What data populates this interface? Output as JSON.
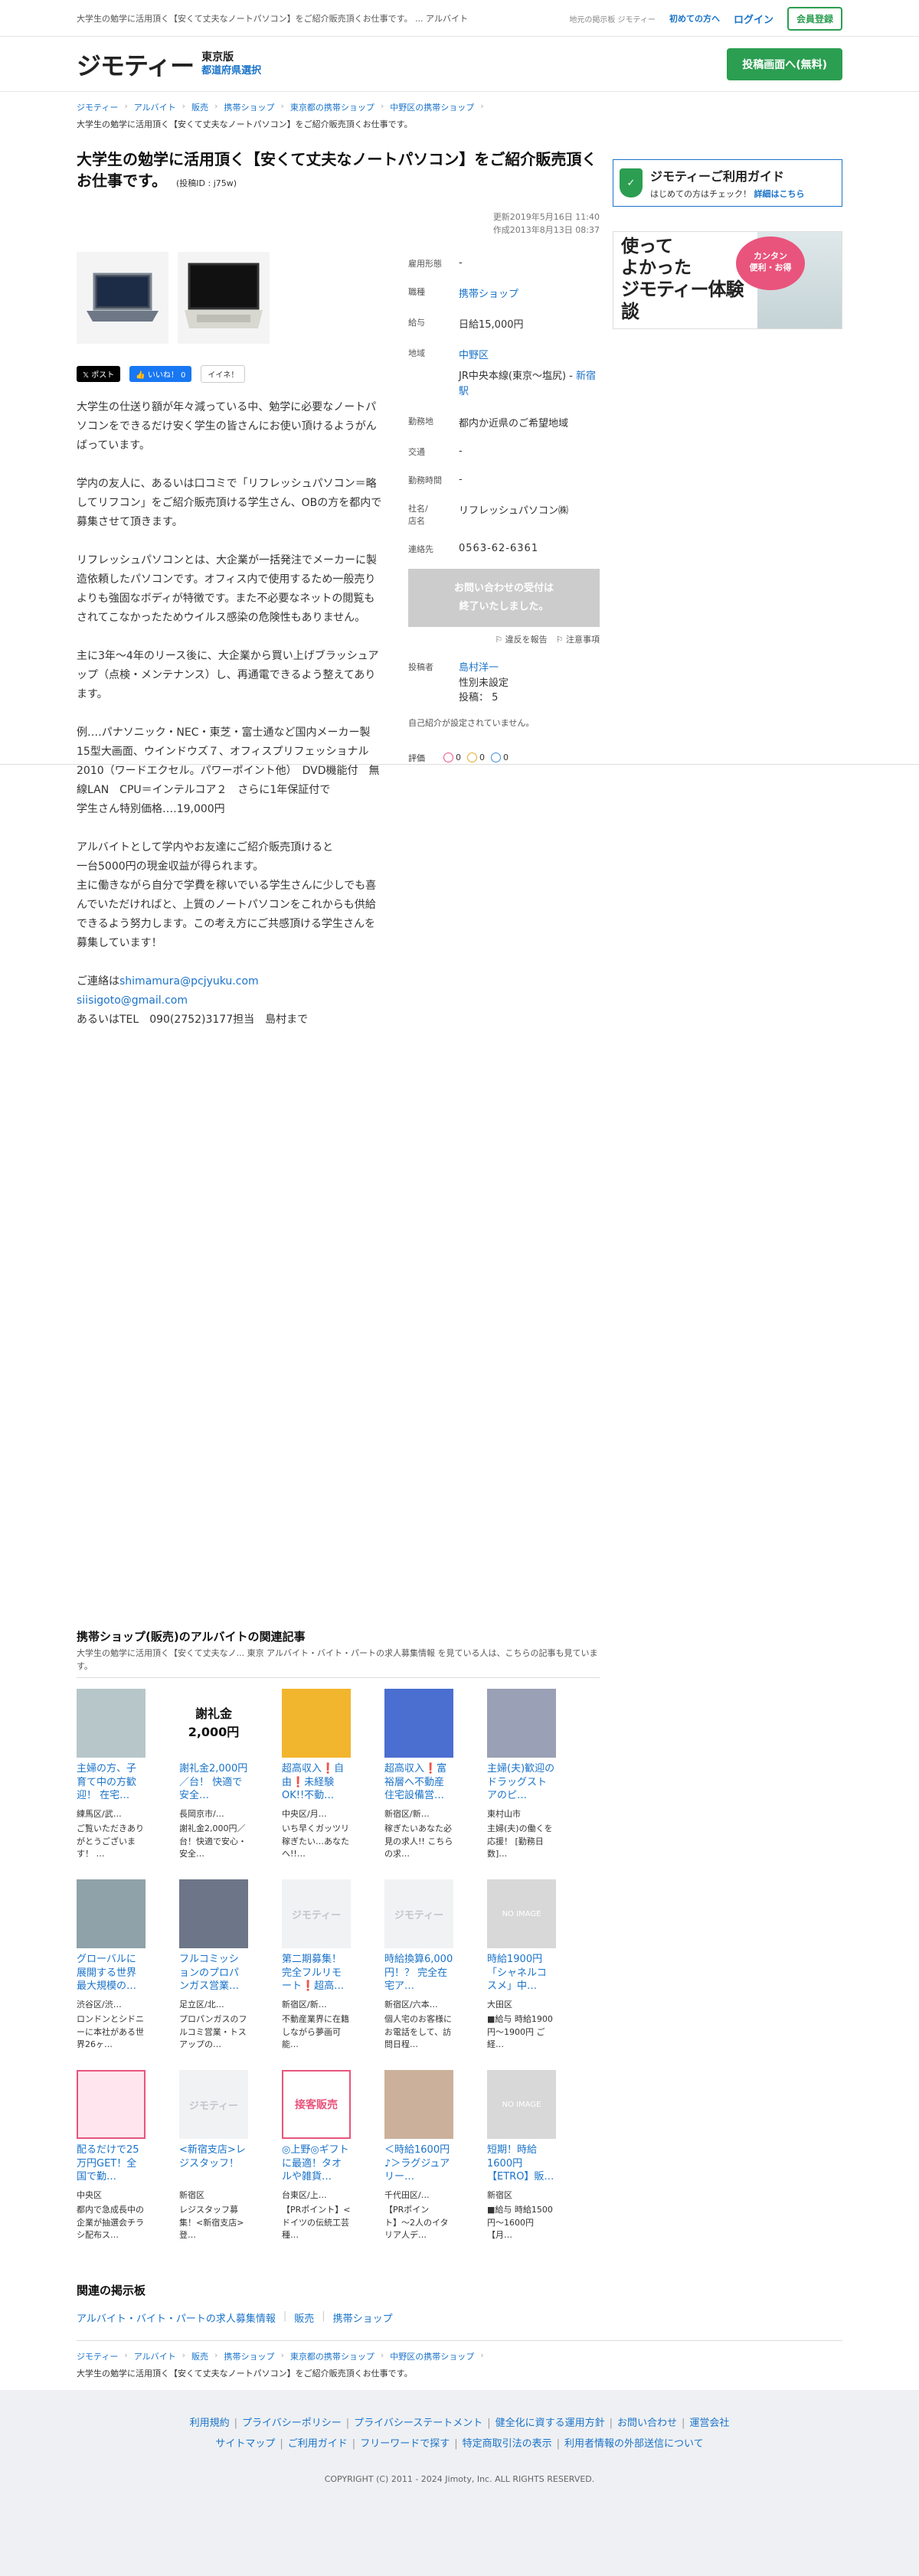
{
  "topbar": {
    "tagline": "大学生の勉学に活用頂く【安くて丈夫なノートパソコン】をご紹介販売頂くお仕事です。 ... アルバイト",
    "local_bbs": "地元の掲示板 ジモティー",
    "first_time": "初めての方へ",
    "login": "ログイン",
    "register": "会員登録"
  },
  "header": {
    "logo": "ジモティー",
    "prefecture": "東京版",
    "select_prefecture": "都道府県選択",
    "post_button": "投稿画面へ(無料)"
  },
  "breadcrumb": {
    "items": [
      "ジモティー",
      "アルバイト",
      "販売",
      "携帯ショップ",
      "東京都の携帯ショップ",
      "中野区の携帯ショップ"
    ],
    "current": "大学生の勉学に活用頂く【安くて丈夫なノートパソコン】をご紹介販売頂くお仕事です。"
  },
  "post": {
    "title": "大学生の勉学に活用頂く【安くて丈夫なノートパソコン】をご紹介販売頂くお仕事です。",
    "post_id": "(投稿ID : j75w)",
    "updated": "更新2019年5月16日 11:40",
    "created": "作成2013年8月13日 08:37",
    "social": {
      "x": "𝕏 ポスト",
      "fb": "👍 いいね！ 0",
      "hatena": "イイネ！"
    },
    "body": [
      "大学生の仕送り額が年々減っている中、勉学に必要なノートパソコンをできるだけ安く学生の皆さんにお使い頂けるようがんばっています。",
      "学内の友人に、あるいは口コミで「リフレッシュパソコン＝略してリフコン」をご紹介販売頂ける学生さん、OBの方を都内で募集させて頂きます。",
      "リフレッシュパソコンとは、大企業が一括発注でメーカーに製造依頼したパソコンです。オフィス内で使用するため一般売りよりも強固なボディが特徴です。また不必要なネットの閲覧もされてこなかったためウイルス感染の危険性もありません。",
      "主に3年〜4年のリース後に、大企業から買い上げブラッシュアップ（点検・メンテナンス）し、再通電できるよう整えてあります。",
      "例‥‥パナソニック・NEC・東芝・富士通など国内メーカー製15型大画面、ウインドウズ７、オフィスプリフェッショナル2010（ワードエクセル。パワーポイント他）　DVD機能付　無線LAN　CPU＝インテルコア２　さらに1年保証付で\n学生さん特別価格‥‥19,000円",
      "アルバイトとして学内やお友達にご紹介販売頂けると\n一台5000円の現金収益が得られます。\n主に働きながら自分で学費を稼いでいる学生さんに少しでも喜んでいただければと、上質のノートパソコンをこれからも供給できるよう努力します。この考え方にご共感頂ける学生さんを募集しています！"
    ],
    "contact_prefix": "ご連絡は",
    "contact_email1": "shimamura@pcjyuku.com",
    "contact_email2": "siisigoto@gmail.com",
    "contact_tel": "あるいはTEL　090(2752)3177担当　島村まで"
  },
  "info": [
    {
      "k": "雇用形態",
      "v": "-"
    },
    {
      "k": "職種",
      "v": "携帯ショップ",
      "link": true
    },
    {
      "k": "給与",
      "v": "日給15,000円"
    },
    {
      "k": "地域",
      "v": "中野区",
      "link": true,
      "sub1": "JR中央本線(東京〜塩尻) - ",
      "sub2": "新宿駅"
    },
    {
      "k": "勤務地",
      "v": "都内か近県のご希望地域"
    },
    {
      "k": "交通",
      "v": "-"
    },
    {
      "k": "勤務時間",
      "v": "-"
    },
    {
      "k": "社名/\n店名",
      "v": "リフレッシュパソコン㈱"
    },
    {
      "k": "連絡先",
      "v": "0563-62-6361"
    }
  ],
  "closed_notice": "お問い合わせの受付は\n終了いたしました。",
  "report": "⚐ 違反を報告　⚐ 注意事項",
  "poster": {
    "label": "投稿者",
    "name": "島村洋一",
    "gender": "性別未設定",
    "posts": "投稿： 5",
    "no_self": "自己紹介が設定されていません。",
    "rating_label": "評価",
    "good": "0",
    "normal": "0",
    "bad": "0"
  },
  "side": {
    "guide_title": "ジモティーご利用ガイド",
    "guide_sub": "はじめての方はチェック！",
    "guide_link": "詳細はこちら",
    "banner_line1": "使って",
    "banner_line2": "よかった",
    "banner_line3": "ジモティー体験談",
    "banner_bubble": "カンタン\n便利・お得"
  },
  "related": {
    "title": "携帯ショップ(販売)のアルバイトの関連記事",
    "desc": "大学生の勉学に活用頂く【安くて丈夫なノ... 東京 アルバイト・バイト・パートの求人募集情報 を見ている人は、こちらの記事も見ています。",
    "items": [
      {
        "thumb": "c1",
        "title": "主婦の方、子育て中の方歓迎！ 在宅…",
        "loc": "練馬区/武…",
        "snip": "ご覧いただきありがとうございます！ …"
      },
      {
        "thumb": "cash",
        "thumb_text1": "謝礼金",
        "thumb_text2": "2,000円",
        "title": "謝礼金2,000円／台！ 快適で安全…",
        "loc": "長岡京市/…",
        "snip": "謝礼金2,000円／台！快適で安心・安全…"
      },
      {
        "thumb": "c3",
        "title": "超高収入❗️自由❗️未経験OK!!不動…",
        "loc": "中央区/月…",
        "snip": "いち早くガッツリ稼ぎたい…あなたへ!!…"
      },
      {
        "thumb": "c4",
        "title": "超高収入❗️富裕層へ不動産住宅設備営…",
        "loc": "新宿区/新…",
        "snip": "稼ぎたいあなた必見の求人!! こちらの求…"
      },
      {
        "thumb": "c5",
        "title": "主婦(夫)歓迎のドラッグストアのピ…",
        "loc": "東村山市",
        "snip": "主婦(夫)の働くを応援！ [勤務日数]…"
      },
      {
        "thumb": "c6",
        "title": "グローバルに展開する世界最大規模の…",
        "loc": "渋谷区/渋…",
        "snip": "ロンドンとシドニーに本社がある世界26ヶ…"
      },
      {
        "thumb": "c7",
        "title": "フルコミッションのプロパンガス営業…",
        "loc": "足立区/北…",
        "snip": "プロパンガスのフルコミ営業・トスアップの…"
      },
      {
        "thumb": "jmt",
        "thumb_text1": "ジモティー",
        "title": "第二期募集！完全フルリモート❗️超高…",
        "loc": "新宿区/新…",
        "snip": "不動産業界に在籍しながら夢画可能…"
      },
      {
        "thumb": "jmt",
        "thumb_text1": "ジモティー",
        "title": "時給換算6,000円！？ 完全在宅ア…",
        "loc": "新宿区/六本…",
        "snip": "個人宅のお客様にお電話をして、訪問日程…"
      },
      {
        "thumb": "noimg",
        "thumb_text1": "NO IMAGE",
        "title": "時給1900円「シャネルコスメ」中…",
        "loc": "大田区",
        "snip": "■給与 時給1900円〜1900円 ご経…"
      },
      {
        "thumb": "c11",
        "title": "配るだけで25万円GET！全国で勤…",
        "loc": "中央区",
        "snip": "都内で急成長中の企業が抽選会チラシ配布ス…"
      },
      {
        "thumb": "jmt",
        "thumb_text1": "ジモティー",
        "title": "<新宿支店>レジスタッフ！",
        "loc": "新宿区",
        "snip": "レジスタッフ募集！<新宿支店>登…"
      },
      {
        "thumb": "c13",
        "thumb_text1": "接客販売",
        "title": "◎上野◎ギフトに最適！タオルや雑貨…",
        "loc": "台東区/上…",
        "snip": "【PRポイント】<ドイツの伝統工芸種…"
      },
      {
        "thumb": "c14",
        "title": "＜時給1600円♪＞ラグジュアリー…",
        "loc": "千代田区/…",
        "snip": "【PRポイント】〜2人のイタリア人デ…"
      },
      {
        "thumb": "noimg",
        "thumb_text1": "NO IMAGE",
        "title": "短期！時給1600円【ETRO】販…",
        "loc": "新宿区",
        "snip": "■給与 時給1500円〜1600円【月…"
      }
    ]
  },
  "bbs": {
    "title": "関連の掲示板",
    "links": [
      "アルバイト・バイト・パートの求人募集情報",
      "販売",
      "携帯ショップ"
    ]
  },
  "footer": {
    "row1": [
      "利用規約",
      "プライバシーポリシー",
      "プライバシーステートメント",
      "健全化に資する運用方針",
      "お問い合わせ",
      "運営会社"
    ],
    "row2": [
      "サイトマップ",
      "ご利用ガイド",
      "フリーワードで探す",
      "特定商取引法の表示",
      "利用者情報の外部送信について"
    ],
    "copyright": "COPYRIGHT (C) 2011 - 2024 Jimoty, Inc. ALL RIGHTS RESERVED."
  }
}
